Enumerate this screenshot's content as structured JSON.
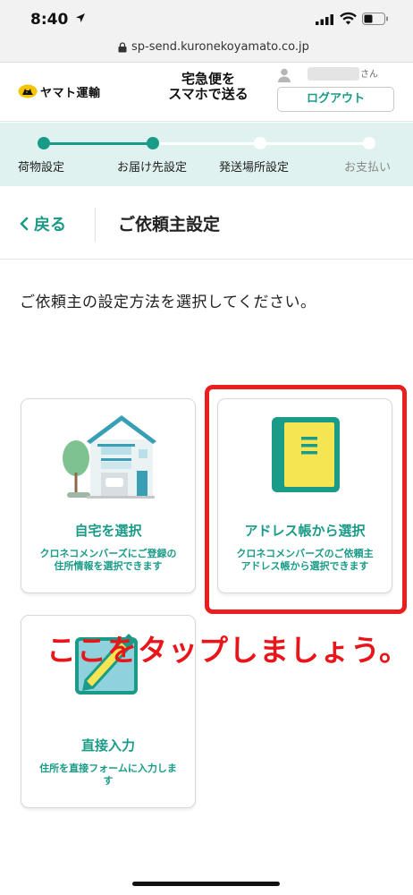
{
  "status_bar": {
    "time": "8:40"
  },
  "browser": {
    "url": "sp-send.kuronekoyamato.co.jp"
  },
  "header": {
    "logo_text": "ヤマト運輸",
    "tagline_line1": "宅急便を",
    "tagline_line2": "スマホで送る",
    "user_suffix": "さん",
    "logout_label": "ログアウト"
  },
  "progress": {
    "steps": [
      {
        "label": "荷物設定",
        "state": "done"
      },
      {
        "label": "お届け先設定",
        "state": "current"
      },
      {
        "label": "発送場所設定",
        "state": "pending"
      },
      {
        "label": "お支払い",
        "state": "pending"
      }
    ],
    "colors": {
      "active": "#1a9b88",
      "pending": "#ffffff",
      "background": "#dff2f0"
    }
  },
  "page": {
    "back_label": "戻る",
    "title": "ご依頼主設定",
    "instruction": "ご依頼主の設定方法を選択してください。"
  },
  "options": [
    {
      "title": "自宅を選択",
      "desc_line1": "クロネコメンバーズにご登録の",
      "desc_line2": "住所情報を選択できます",
      "icon": "house-icon"
    },
    {
      "title": "アドレス帳から選択",
      "desc_line1": "クロネコメンバーズのご依頼主",
      "desc_line2": "アドレス帳から選択できます",
      "icon": "address-book-icon"
    },
    {
      "title": "直接入力",
      "desc_line1": "住所を直接フォームに入力しま",
      "desc_line2": "す",
      "icon": "pencil-form-icon"
    }
  ],
  "annotation": {
    "text": "ここをタップしましょう。",
    "color": "#e8161b"
  },
  "colors": {
    "brand": "#1a9b88",
    "highlight": "#ea1e1e"
  }
}
